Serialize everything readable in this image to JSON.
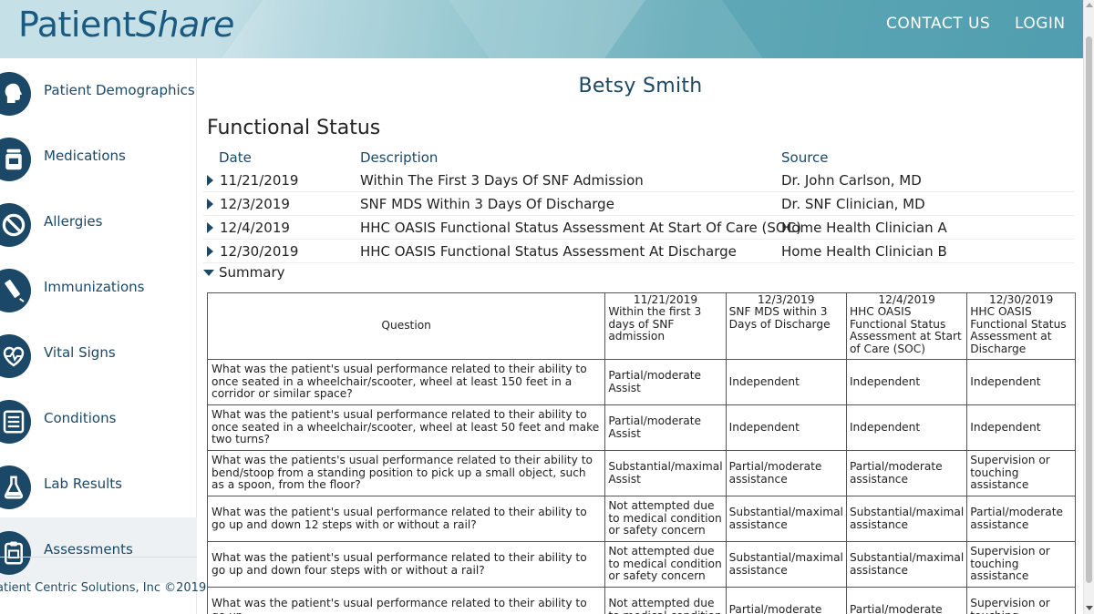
{
  "header": {
    "logo_patient": "Patient",
    "logo_share": "Share",
    "contact": "CONTACT US",
    "login": "LOGIN"
  },
  "sidebar": {
    "items": [
      {
        "label": "Patient Demographics",
        "icon": "head-icon"
      },
      {
        "label": "Medications",
        "icon": "pill-bottle-icon"
      },
      {
        "label": "Allergies",
        "icon": "prohibited-icon"
      },
      {
        "label": "Immunizations",
        "icon": "syringe-icon"
      },
      {
        "label": "Vital Signs",
        "icon": "heartbeat-icon"
      },
      {
        "label": "Conditions",
        "icon": "list-icon"
      },
      {
        "label": "Lab Results",
        "icon": "flask-icon"
      },
      {
        "label": "Assessments",
        "icon": "clipboard-icon"
      }
    ],
    "active": "Assessments",
    "copyright": "atient Centric Solutions, Inc ©2019"
  },
  "main": {
    "patient_name": "Betsy Smith",
    "section_title": "Functional Status",
    "columns": {
      "date": "Date",
      "description": "Description",
      "source": "Source"
    },
    "rows": [
      {
        "date": "11/21/2019",
        "description": "Within The First 3 Days Of SNF Admission",
        "source": "Dr. John Carlson, MD"
      },
      {
        "date": "12/3/2019",
        "description": "SNF MDS Within 3 Days Of Discharge",
        "source": "Dr. SNF Clinician, MD"
      },
      {
        "date": "12/4/2019",
        "description": "HHC OASIS Functional Status Assessment At Start Of Care (SOC)",
        "source": "Home Health Clinician A"
      },
      {
        "date": "12/30/2019",
        "description": "HHC OASIS Functional Status Assessment At Discharge",
        "source": "Home Health Clinician B"
      }
    ],
    "summary_label": "Summary"
  },
  "summary_table": {
    "question_header": "Question",
    "col_headers": [
      {
        "date": "11/21/2019",
        "desc": "Within the first 3 days of SNF admission"
      },
      {
        "date": "12/3/2019",
        "desc": "SNF MDS within 3 Days of Discharge"
      },
      {
        "date": "12/4/2019",
        "desc": "HHC OASIS Functional Status Assessment at Start of Care (SOC)"
      },
      {
        "date": "12/30/2019",
        "desc": "HHC OASIS Functional Status Assessment at Discharge"
      }
    ],
    "rows": [
      {
        "q": "What was the patient's usual performance related to their ability to once seated in a wheelchair/scooter, wheel at least 150 feet in a corridor or similar space?",
        "v": [
          "Partial/moderate Assist",
          "Independent",
          "Independent",
          "Independent"
        ]
      },
      {
        "q": "What was the patient's usual performance related to their ability to once seated in a wheelchair/scooter, wheel at least 50 feet and make two turns?",
        "v": [
          "Partial/moderate Assist",
          "Independent",
          "Independent",
          "Independent"
        ]
      },
      {
        "q": "What was the patients's usual performance related to their ability to bend/stoop from a standing position to pick up a small object, such as a spoon, from the floor?",
        "v": [
          "Substantial/maximal Assist",
          "Partial/moderate assistance",
          "Partial/moderate assistance",
          "Supervision or touching assistance"
        ]
      },
      {
        "q": "What was the patient's usual performance related to their ability to go up and down 12 steps with or without a rail?",
        "v": [
          "Not attempted due to medical condition or safety concern",
          "Substantial/maximal assistance",
          "Substantial/maximal assistance",
          "Partial/moderate assistance"
        ]
      },
      {
        "q": "What was the patient's usual performance related to their ability to go up and down four steps with or without a rail?",
        "v": [
          "Not attempted due to medical condition or safety concern",
          "Substantial/maximal assistance",
          "Substantial/maximal assistance",
          "Supervision or touching assistance"
        ]
      },
      {
        "q": "What was the patient's usual performance related to their ability to go up",
        "v": [
          "Not attempted due to medical condition",
          "Partial/moderate",
          "Partial/moderate",
          "Supervision or touching"
        ]
      }
    ]
  }
}
